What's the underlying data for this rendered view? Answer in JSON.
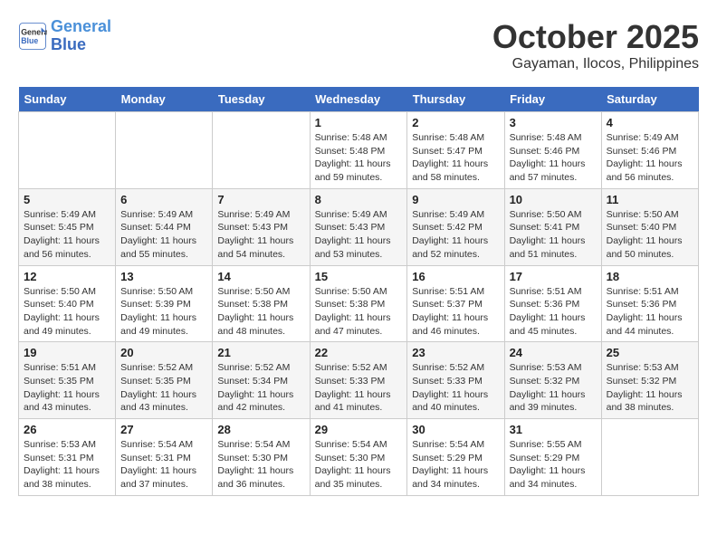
{
  "header": {
    "logo_line1": "General",
    "logo_line2": "Blue",
    "month": "October 2025",
    "location": "Gayaman, Ilocos, Philippines"
  },
  "weekdays": [
    "Sunday",
    "Monday",
    "Tuesday",
    "Wednesday",
    "Thursday",
    "Friday",
    "Saturday"
  ],
  "weeks": [
    [
      {
        "day": "",
        "sunrise": "",
        "sunset": "",
        "daylight": ""
      },
      {
        "day": "",
        "sunrise": "",
        "sunset": "",
        "daylight": ""
      },
      {
        "day": "",
        "sunrise": "",
        "sunset": "",
        "daylight": ""
      },
      {
        "day": "1",
        "sunrise": "Sunrise: 5:48 AM",
        "sunset": "Sunset: 5:48 PM",
        "daylight": "Daylight: 11 hours and 59 minutes."
      },
      {
        "day": "2",
        "sunrise": "Sunrise: 5:48 AM",
        "sunset": "Sunset: 5:47 PM",
        "daylight": "Daylight: 11 hours and 58 minutes."
      },
      {
        "day": "3",
        "sunrise": "Sunrise: 5:48 AM",
        "sunset": "Sunset: 5:46 PM",
        "daylight": "Daylight: 11 hours and 57 minutes."
      },
      {
        "day": "4",
        "sunrise": "Sunrise: 5:49 AM",
        "sunset": "Sunset: 5:46 PM",
        "daylight": "Daylight: 11 hours and 56 minutes."
      }
    ],
    [
      {
        "day": "5",
        "sunrise": "Sunrise: 5:49 AM",
        "sunset": "Sunset: 5:45 PM",
        "daylight": "Daylight: 11 hours and 56 minutes."
      },
      {
        "day": "6",
        "sunrise": "Sunrise: 5:49 AM",
        "sunset": "Sunset: 5:44 PM",
        "daylight": "Daylight: 11 hours and 55 minutes."
      },
      {
        "day": "7",
        "sunrise": "Sunrise: 5:49 AM",
        "sunset": "Sunset: 5:43 PM",
        "daylight": "Daylight: 11 hours and 54 minutes."
      },
      {
        "day": "8",
        "sunrise": "Sunrise: 5:49 AM",
        "sunset": "Sunset: 5:43 PM",
        "daylight": "Daylight: 11 hours and 53 minutes."
      },
      {
        "day": "9",
        "sunrise": "Sunrise: 5:49 AM",
        "sunset": "Sunset: 5:42 PM",
        "daylight": "Daylight: 11 hours and 52 minutes."
      },
      {
        "day": "10",
        "sunrise": "Sunrise: 5:50 AM",
        "sunset": "Sunset: 5:41 PM",
        "daylight": "Daylight: 11 hours and 51 minutes."
      },
      {
        "day": "11",
        "sunrise": "Sunrise: 5:50 AM",
        "sunset": "Sunset: 5:40 PM",
        "daylight": "Daylight: 11 hours and 50 minutes."
      }
    ],
    [
      {
        "day": "12",
        "sunrise": "Sunrise: 5:50 AM",
        "sunset": "Sunset: 5:40 PM",
        "daylight": "Daylight: 11 hours and 49 minutes."
      },
      {
        "day": "13",
        "sunrise": "Sunrise: 5:50 AM",
        "sunset": "Sunset: 5:39 PM",
        "daylight": "Daylight: 11 hours and 49 minutes."
      },
      {
        "day": "14",
        "sunrise": "Sunrise: 5:50 AM",
        "sunset": "Sunset: 5:38 PM",
        "daylight": "Daylight: 11 hours and 48 minutes."
      },
      {
        "day": "15",
        "sunrise": "Sunrise: 5:50 AM",
        "sunset": "Sunset: 5:38 PM",
        "daylight": "Daylight: 11 hours and 47 minutes."
      },
      {
        "day": "16",
        "sunrise": "Sunrise: 5:51 AM",
        "sunset": "Sunset: 5:37 PM",
        "daylight": "Daylight: 11 hours and 46 minutes."
      },
      {
        "day": "17",
        "sunrise": "Sunrise: 5:51 AM",
        "sunset": "Sunset: 5:36 PM",
        "daylight": "Daylight: 11 hours and 45 minutes."
      },
      {
        "day": "18",
        "sunrise": "Sunrise: 5:51 AM",
        "sunset": "Sunset: 5:36 PM",
        "daylight": "Daylight: 11 hours and 44 minutes."
      }
    ],
    [
      {
        "day": "19",
        "sunrise": "Sunrise: 5:51 AM",
        "sunset": "Sunset: 5:35 PM",
        "daylight": "Daylight: 11 hours and 43 minutes."
      },
      {
        "day": "20",
        "sunrise": "Sunrise: 5:52 AM",
        "sunset": "Sunset: 5:35 PM",
        "daylight": "Daylight: 11 hours and 43 minutes."
      },
      {
        "day": "21",
        "sunrise": "Sunrise: 5:52 AM",
        "sunset": "Sunset: 5:34 PM",
        "daylight": "Daylight: 11 hours and 42 minutes."
      },
      {
        "day": "22",
        "sunrise": "Sunrise: 5:52 AM",
        "sunset": "Sunset: 5:33 PM",
        "daylight": "Daylight: 11 hours and 41 minutes."
      },
      {
        "day": "23",
        "sunrise": "Sunrise: 5:52 AM",
        "sunset": "Sunset: 5:33 PM",
        "daylight": "Daylight: 11 hours and 40 minutes."
      },
      {
        "day": "24",
        "sunrise": "Sunrise: 5:53 AM",
        "sunset": "Sunset: 5:32 PM",
        "daylight": "Daylight: 11 hours and 39 minutes."
      },
      {
        "day": "25",
        "sunrise": "Sunrise: 5:53 AM",
        "sunset": "Sunset: 5:32 PM",
        "daylight": "Daylight: 11 hours and 38 minutes."
      }
    ],
    [
      {
        "day": "26",
        "sunrise": "Sunrise: 5:53 AM",
        "sunset": "Sunset: 5:31 PM",
        "daylight": "Daylight: 11 hours and 38 minutes."
      },
      {
        "day": "27",
        "sunrise": "Sunrise: 5:54 AM",
        "sunset": "Sunset: 5:31 PM",
        "daylight": "Daylight: 11 hours and 37 minutes."
      },
      {
        "day": "28",
        "sunrise": "Sunrise: 5:54 AM",
        "sunset": "Sunset: 5:30 PM",
        "daylight": "Daylight: 11 hours and 36 minutes."
      },
      {
        "day": "29",
        "sunrise": "Sunrise: 5:54 AM",
        "sunset": "Sunset: 5:30 PM",
        "daylight": "Daylight: 11 hours and 35 minutes."
      },
      {
        "day": "30",
        "sunrise": "Sunrise: 5:54 AM",
        "sunset": "Sunset: 5:29 PM",
        "daylight": "Daylight: 11 hours and 34 minutes."
      },
      {
        "day": "31",
        "sunrise": "Sunrise: 5:55 AM",
        "sunset": "Sunset: 5:29 PM",
        "daylight": "Daylight: 11 hours and 34 minutes."
      },
      {
        "day": "",
        "sunrise": "",
        "sunset": "",
        "daylight": ""
      }
    ]
  ]
}
